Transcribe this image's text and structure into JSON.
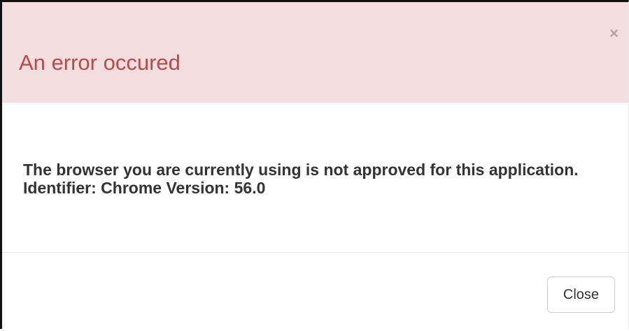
{
  "dialog": {
    "title": "An error occured",
    "dismiss_icon": "×",
    "message": "The browser you are currently using is not approved for this application. Identifier: Chrome Version: 56.0",
    "close_label": "Close"
  },
  "colors": {
    "header_background": "#f2dede",
    "title_text": "#b94a48",
    "body_text": "#333333",
    "button_border": "#cccccc"
  },
  "icons": {
    "dismiss": "close-icon"
  }
}
